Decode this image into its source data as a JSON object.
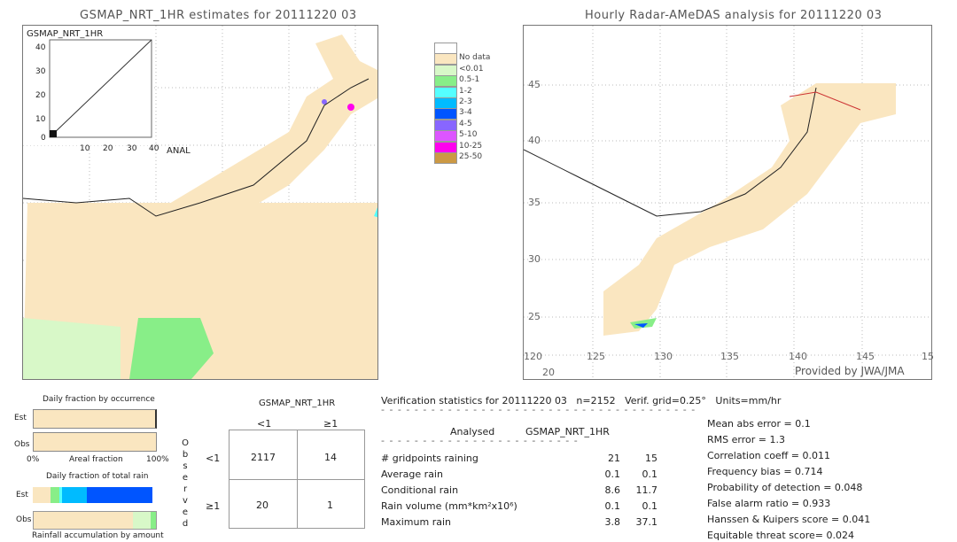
{
  "left_map": {
    "title": "GSMAP_NRT_1HR estimates for 20111220 03",
    "inset_title": "GSMAP_NRT_1HR",
    "inset_xlabel": "ANAL",
    "inset_ticks": [
      "0",
      "10",
      "20",
      "30",
      "40"
    ]
  },
  "right_map": {
    "title": "Hourly Radar-AMeDAS analysis for 20111220 03",
    "credit": "Provided by JWA/JMA",
    "lon_ticks": [
      "120",
      "125",
      "130",
      "135",
      "140",
      "145",
      "15"
    ],
    "lat_ticks": [
      "45",
      "40",
      "35",
      "30",
      "25",
      "20"
    ]
  },
  "legend": [
    {
      "label": "",
      "color": "#ffffff"
    },
    {
      "label": "No data",
      "color": "#fae6c0"
    },
    {
      "label": "<0.01",
      "color": "#d8f8c8"
    },
    {
      "label": "0.5-1",
      "color": "#88ee88"
    },
    {
      "label": "1-2",
      "color": "#55ffff"
    },
    {
      "label": "2-3",
      "color": "#00bbff"
    },
    {
      "label": "3-4",
      "color": "#0055ff"
    },
    {
      "label": "4-5",
      "color": "#8866ff"
    },
    {
      "label": "5-10",
      "color": "#dd55ff"
    },
    {
      "label": "10-25",
      "color": "#ff00ee"
    },
    {
      "label": "25-50",
      "color": "#cc9944"
    }
  ],
  "occurrence": {
    "title": "Daily fraction by occurrence",
    "est": "Est",
    "obs": "Obs",
    "x0": "0%",
    "xlabel": "Areal fraction",
    "x1": "100%"
  },
  "total_rain": {
    "title": "Daily fraction of total rain",
    "est": "Est",
    "obs": "Obs",
    "xlabel": "Rainfall accumulation by amount"
  },
  "contingency": {
    "title": "GSMAP_NRT_1HR",
    "cols": [
      "<1",
      "≥1"
    ],
    "rows": [
      "<1",
      "≥1"
    ],
    "observed_label": [
      "O",
      "b",
      "s",
      "e",
      "r",
      "v",
      "e",
      "d"
    ],
    "values": [
      [
        "2117",
        "14"
      ],
      [
        "20",
        "1"
      ]
    ]
  },
  "stats": {
    "header": "Verification statistics for 20111220 03   n=2152   Verif. grid=0.25°   Units=mm/hr",
    "col1": "Analysed",
    "col2": "GSMAP_NRT_1HR",
    "rows": [
      {
        "label": "# gridpoints raining",
        "a": "21",
        "b": "15"
      },
      {
        "label": "Average rain",
        "a": "0.1",
        "b": "0.1"
      },
      {
        "label": "Conditional rain",
        "a": "8.6",
        "b": "11.7"
      },
      {
        "label": "Rain volume (mm*km²x10⁶)",
        "a": "0.1",
        "b": "0.1"
      },
      {
        "label": "Maximum rain",
        "a": "3.8",
        "b": "37.1"
      }
    ],
    "scores": [
      "Mean abs error = 0.1",
      "RMS error = 1.3",
      "Correlation coeff = 0.011",
      "Frequency bias = 0.714",
      "Probability of detection = 0.048",
      "False alarm ratio = 0.933",
      "Hanssen & Kuipers score = 0.041",
      "Equitable threat score= 0.024"
    ]
  }
}
